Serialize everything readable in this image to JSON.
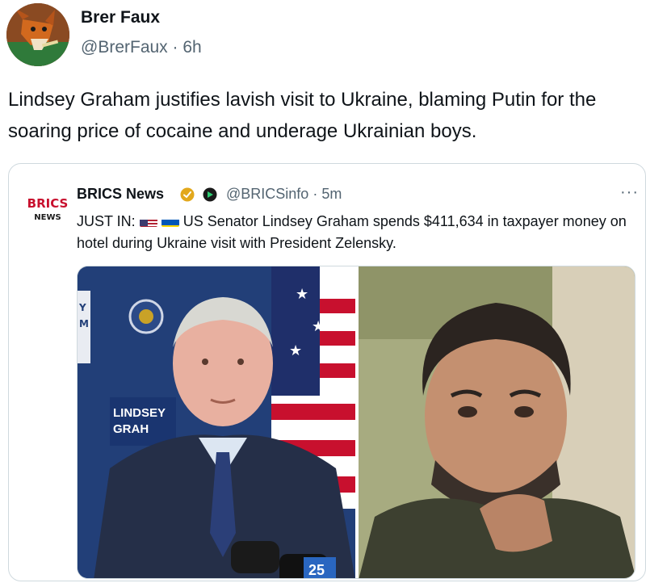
{
  "post": {
    "author_name": "Brer Faux",
    "author_handle": "@BrerFaux",
    "separator": "·",
    "time": "6h",
    "text": "Lindsey Graham justifies lavish visit to Ukraine, blaming Putin for the soaring price of cocaine and underage Ukrainian boys."
  },
  "quote": {
    "logo_text": "BRICS",
    "logo_subtext": "NEWS",
    "author_name": "BRICS News",
    "author_handle": "@BRICSinfo",
    "separator": "·",
    "time": "5m",
    "more_label": "···",
    "text_prefix": "JUST IN:",
    "text_body": "US Senator Lindsey Graham spends $411,634 in taxpayer money on hotel during Ukraine visit with President Zelensky.",
    "photo_left_sign_text": "LINDSEY GRAH",
    "photo_left_edge_text": "Y M",
    "photo_right_alt": "",
    "mic_label": "25"
  },
  "colors": {
    "verified_gold": "#e2a81c",
    "handle_gray": "#536471",
    "border": "#cfd9de",
    "brics_red": "#c8102e",
    "brics_blue": "#1d3f8f"
  }
}
